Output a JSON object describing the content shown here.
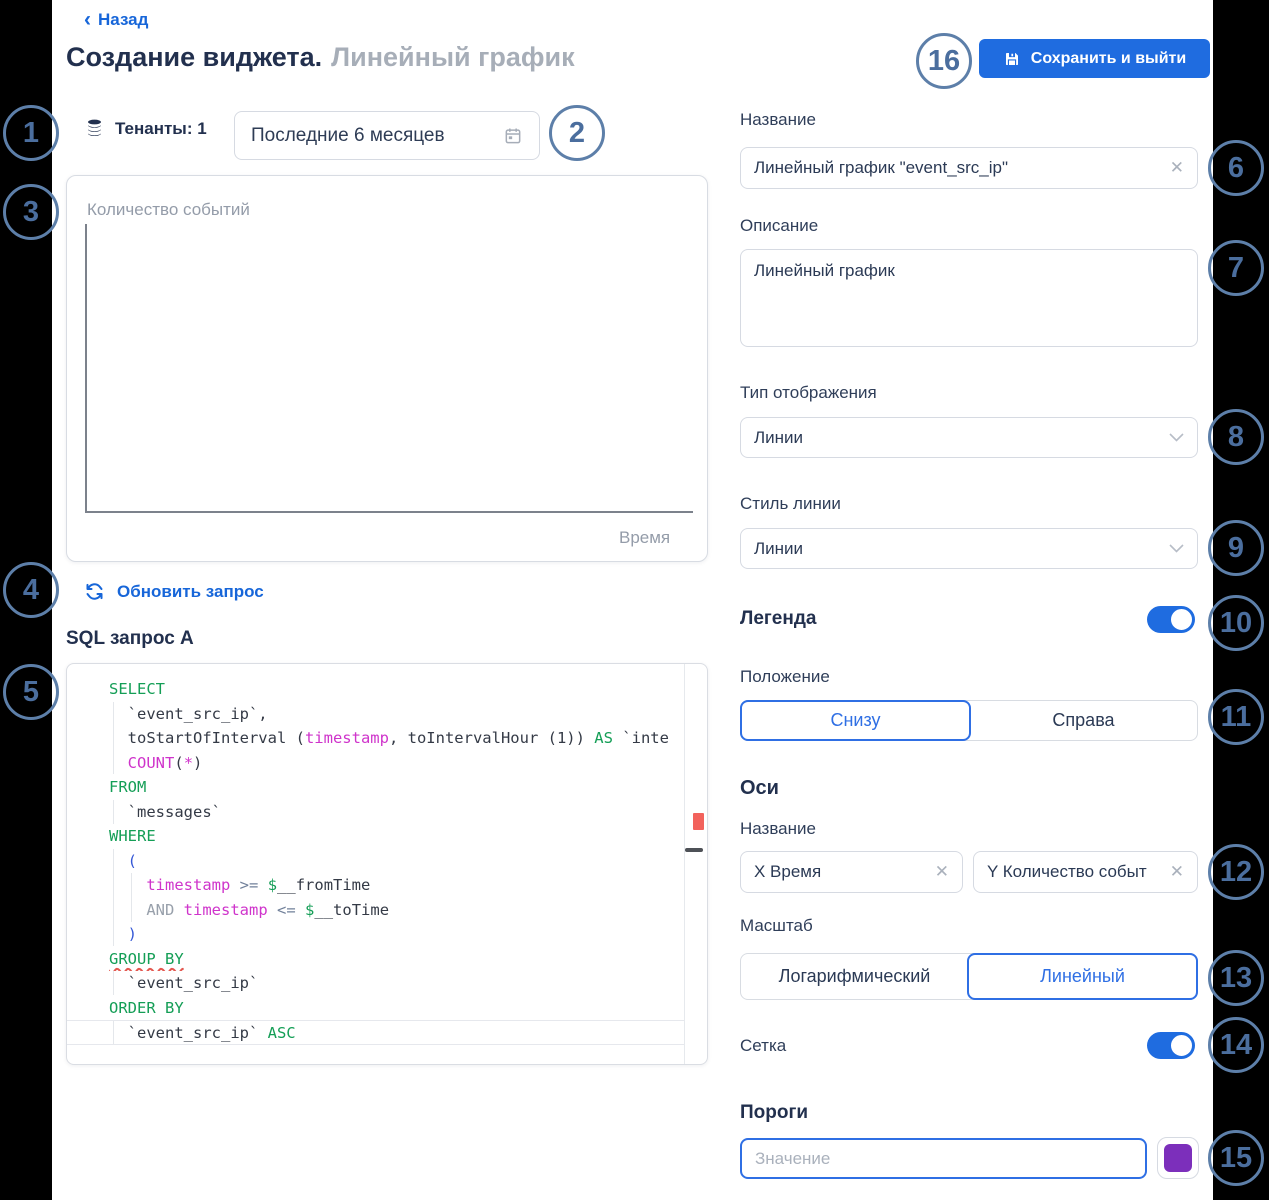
{
  "header": {
    "back": "Назад",
    "title_bold": "Создание виджета.",
    "title_gray": "Линейный график",
    "save_button": "Сохранить и выйти"
  },
  "toolbar": {
    "tenants_label": "Тенанты: 1",
    "date_range": "Последние 6 месяцев"
  },
  "chart_preview": {
    "y_axis_label": "Количество событий",
    "x_axis_label": "Время"
  },
  "query": {
    "refresh_label": "Обновить запрос",
    "sql_title": "SQL запрос A"
  },
  "sql": {
    "current_line": 14,
    "lines": [
      [
        [
          "kw",
          "SELECT"
        ]
      ],
      [
        [
          "d",
          "  `event_src_ip`,"
        ]
      ],
      [
        [
          "d",
          "  toStartOfInterval ("
        ],
        [
          "m",
          "timestamp"
        ],
        [
          "d",
          ", toIntervalHour (1)) "
        ],
        [
          "kw",
          "AS"
        ],
        [
          "d",
          " `inte"
        ]
      ],
      [
        [
          "d",
          "  "
        ],
        [
          "m",
          "COUNT"
        ],
        [
          "d",
          "("
        ],
        [
          "m",
          "*"
        ],
        [
          "d",
          ")"
        ]
      ],
      [
        [
          "kw",
          "FROM"
        ]
      ],
      [
        [
          "d",
          "  `messages`"
        ]
      ],
      [
        [
          "kw",
          "WHERE"
        ]
      ],
      [
        [
          "d",
          "  "
        ],
        [
          "p",
          "("
        ]
      ],
      [
        [
          "d",
          "    "
        ],
        [
          "m",
          "timestamp"
        ],
        [
          "d",
          " "
        ],
        [
          "op",
          ">="
        ],
        [
          "d",
          " "
        ],
        [
          "kw",
          "$"
        ],
        [
          "d",
          "__fromTime"
        ]
      ],
      [
        [
          "d",
          "    "
        ],
        [
          "and",
          "AND"
        ],
        [
          "d",
          " "
        ],
        [
          "m",
          "timestamp"
        ],
        [
          "d",
          " "
        ],
        [
          "op",
          "<="
        ],
        [
          "d",
          " "
        ],
        [
          "kw",
          "$"
        ],
        [
          "d",
          "__toTime"
        ]
      ],
      [
        [
          "d",
          "  "
        ],
        [
          "p",
          ")"
        ]
      ],
      [
        [
          "kwerr",
          "GROUP BY"
        ]
      ],
      [
        [
          "d",
          "  `event_src_ip`"
        ]
      ],
      [
        [
          "kw",
          "ORDER BY"
        ]
      ],
      [
        [
          "d",
          "  `event_src_ip` "
        ],
        [
          "kw",
          "ASC"
        ]
      ]
    ]
  },
  "form": {
    "name_label": "Название",
    "name_value": "Линейный график \"event_src_ip\"",
    "description_label": "Описание",
    "description_value": "Линейный график",
    "display_type_label": "Тип отображения",
    "display_type_value": "Линии",
    "line_style_label": "Стиль линии",
    "line_style_value": "Линии",
    "legend_label": "Легенда",
    "position_label": "Положение",
    "position_options": [
      "Снизу",
      "Справа"
    ],
    "axes_heading": "Оси",
    "axes_name_label": "Название",
    "axis_x_value": "X Время",
    "axis_y_value": "Y Количество событ",
    "scale_label": "Масштаб",
    "scale_options": [
      "Логарифмический",
      "Линейный"
    ],
    "grid_label": "Сетка",
    "thresholds_heading": "Пороги",
    "threshold_placeholder": "Значение"
  },
  "icons": {
    "clear_icon": "✕",
    "back_chevron_icon": "‹"
  },
  "colors": {
    "accent_blue": "#1f6ce0",
    "link_blue": "#1766d9",
    "annotation_blue": "#5d7fa9",
    "threshold_swatch_purple": "#7c2fbb",
    "sql_keyword_green": "#149e56",
    "sql_magenta": "#cf34cb",
    "error_marker_red": "#f2625c"
  },
  "annotations": [
    "1",
    "2",
    "3",
    "4",
    "5",
    "6",
    "7",
    "8",
    "9",
    "10",
    "11",
    "12",
    "13",
    "14",
    "15",
    "16"
  ]
}
